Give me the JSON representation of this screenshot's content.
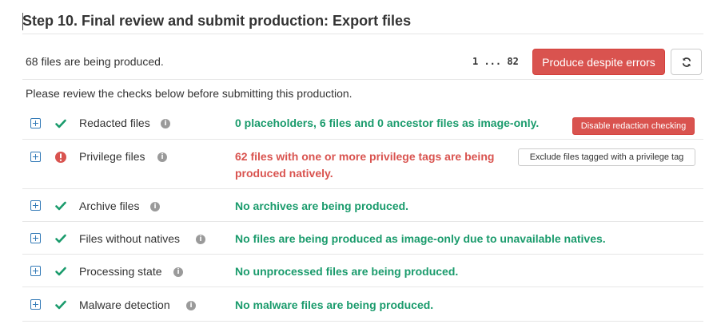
{
  "header": {
    "title": "Step 10. Final review and submit production: Export files"
  },
  "summary": {
    "text": "68 files are being produced.",
    "page_range": "1 ... 82",
    "produce_button": "Produce despite errors",
    "refresh_icon": "refresh-icon"
  },
  "instructions": "Please review the checks below before submitting this production.",
  "colors": {
    "success": "#1a9b6c",
    "danger": "#d9534f",
    "link": "#337ab7"
  },
  "checks": [
    {
      "label": "Redacted files",
      "status": "pass",
      "message": "0 placeholders, 6 files and 0 ancestor files as image-only.",
      "action": "Disable redaction checking"
    },
    {
      "label": "Privilege files",
      "status": "error",
      "message": "62 files with one or more privilege tags are being produced natively.",
      "action": "Exclude files tagged with a privilege tag"
    },
    {
      "label": "Archive files",
      "status": "pass",
      "message": "No archives are being produced."
    },
    {
      "label": "Files without natives",
      "status": "pass",
      "message": "No files are being produced as image-only due to unavailable natives."
    },
    {
      "label": "Processing state",
      "status": "pass",
      "message": "No unprocessed files are being produced."
    },
    {
      "label": "Malware detection",
      "status": "pass",
      "message": "No malware files are being produced."
    }
  ]
}
